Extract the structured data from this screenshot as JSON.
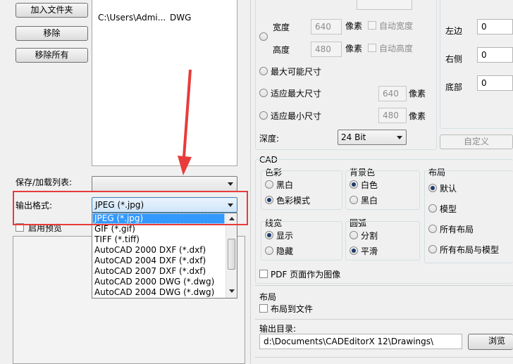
{
  "files": {
    "add_folder_button": "加入文件夹",
    "remove_button": "移除",
    "remove_all_button": "移除所有",
    "list_row": {
      "path": "C:\\Users\\Admi...",
      "type": "DWG"
    }
  },
  "save_load_list_label": "保存/加载列表:",
  "output_format_label": "输出格式:",
  "output_format_value": "JPEG (*.jpg)",
  "enable_preview_label": "启用预览",
  "format_options": [
    "JPEG (*.jpg)",
    "GIF (*.gif)",
    "TIFF (*.tiff)",
    "AutoCAD 2000 DXF (*.dxf)",
    "AutoCAD 2004 DXF (*.dxf)",
    "AutoCAD 2007 DXF (*.dxf)",
    "AutoCAD 2000 DWG (*.dwg)",
    "AutoCAD 2004 DWG (*.dwg)"
  ],
  "size": {
    "width_label": "宽度",
    "width_value": "640",
    "height_label": "高度",
    "height_value": "480",
    "pixel_unit": "像素",
    "auto_width_label": "自动宽度",
    "auto_height_label": "自动高度",
    "max_possible_label": "最大可能尺寸",
    "fit_max_label": "适应最大尺寸",
    "fit_max_value": "640",
    "fit_min_label": "适应最小尺寸",
    "fit_min_value": "480",
    "depth_label": "深度:",
    "depth_value": "24 Bit"
  },
  "margins": {
    "left_label": "左边",
    "right_label": "右侧",
    "bottom_label": "底部",
    "left_value": "0",
    "right_value": "0",
    "bottom_value": "0",
    "custom_button": "自定义"
  },
  "cad": {
    "section_label": "CAD",
    "color_label": "色彩",
    "color_bw": "黑白",
    "color_mode": "色彩模式",
    "bg_label": "背景色",
    "bg_white": "白色",
    "bg_black": "黑白",
    "layout_label": "布局",
    "layout_default": "默认",
    "layout_model": "模型",
    "layout_all": "所有布局",
    "layout_all_model": "所有布局与模型",
    "lineweight_label": "线宽",
    "lw_show": "显示",
    "lw_hide": "隐藏",
    "arc_label": "圆弧",
    "arc_segment": "分割",
    "arc_smooth": "平滑",
    "pdf_as_image": "PDF 页面作为图像"
  },
  "layout_section": {
    "label": "布局",
    "layout_to_file": "布局到文件"
  },
  "output_dir": {
    "label": "输出目录:",
    "value": "d:\\Documents\\CADEditorX 12\\Drawings\\",
    "browse_button": "浏览"
  },
  "colors": {
    "highlight_box": "#e83b3b",
    "arrow": "#e83b3b",
    "selection": "#3399ff"
  }
}
